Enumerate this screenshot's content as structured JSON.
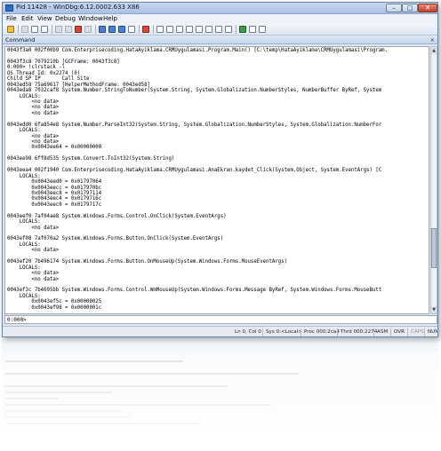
{
  "window": {
    "title": "Pid 11428 - WinDbg:6.12.0002.633 X86",
    "min_symbol": "–",
    "max_symbol": "□",
    "close_symbol": "✕"
  },
  "menu": [
    "File",
    "Edit",
    "View",
    "Debug",
    "Window",
    "Help"
  ],
  "toolbar_icons": [
    "open-icon",
    "cut-icon",
    "copy-icon",
    "paste-icon",
    "go-icon",
    "restart-icon",
    "stop-icon",
    "break-icon",
    "step-into-icon",
    "step-over-icon",
    "step-out-icon",
    "run-to-cursor-icon",
    "breakpoint-icon",
    "command-window-icon",
    "watch-icon",
    "locals-icon",
    "registers-icon",
    "memory-icon",
    "call-stack-icon",
    "disassembly-icon",
    "scratch-pad-icon",
    "source-mode-icon",
    "font-icon",
    "options-icon"
  ],
  "command_panel": {
    "label": "Command",
    "close_symbol": "×",
    "lines": [
      "0043f3a0 002f00b9 Com.Enterprisecoding.HataAyiklama.CRMUygulamasi.Program.Main() [C:\\temp\\HataAyiklama\\CRMUygulamasi\\Program.",
      "",
      "0043f3c8 7079210b [GCFrame: 0043f3c8]",
      "0:000> !clrstack -l",
      "OS Thread Id: 0x2274 (0)",
      "Child SP IP       Call Site",
      "0043ed58 75a69617 [HelperMethodFrame: 0043ed58]",
      "0043eda8 7032caf8 System.Number.StringToNumber(System.String, System.Globalization.NumberStyles, NumberBuffer ByRef, System",
      "    LOCALS:",
      "        <no data>",
      "        <no data>",
      "        <no data>",
      "",
      "0043edd0 6fa854e8 System.Number.ParseInt32(System.String, System.Globalization.NumberStyles, System.Globalization.NumberFor",
      "    LOCALS:",
      "        <no data>",
      "        <no data>",
      "        0x0043ee64 = 0x00000000",
      "",
      "0043ee98 6ff8d535 System.Convert.ToInt32(System.String)",
      "",
      "0043eea4 002f1940 Com.Enterprisecoding.HataAyiklama.CRMUygulamasi.AnaEkran.kaydet_Click(System.Object, System.EventArgs) [C",
      "    LOCALS:",
      "        0x0043eed0 = 0x01797064",
      "        0x0043eecc = 0x017970bc",
      "        0x0043eec8 = 0x01797114",
      "        0x0043eec4 = 0x0179716c",
      "        0x0043eec0 = 0x0179717c",
      "",
      "0043eef0 7af04ae8 System.Windows.Forms.Control.OnClick(System.EventArgs)",
      "    LOCALS:",
      "        <no data>",
      "",
      "0043ef08 7af070a2 System.Windows.Forms.Button.OnClick(System.EventArgs)",
      "    LOCALS:",
      "        <no data>",
      "",
      "0043ef20 7b496174 System.Windows.Forms.Button.OnMouseUp(System.Windows.Forms.MouseEventArgs)",
      "    LOCALS:",
      "        <no data>",
      "        <no data>",
      "",
      "0043ef3c 7b4695bb System.Windows.Forms.Control.WmMouseUp(System.Windows.Forms.Message ByRef, System.Windows.Forms.MouseButt",
      "    LOCALS:",
      "        0x0043ef5c = 0x00000025",
      "        0x0043ef98 = 0x0000001c"
    ]
  },
  "prompt": "0:000>",
  "input_value": "",
  "status": [
    "Ln 0, Col 0",
    "Sys 0:<Local>",
    "Proc 000:2ca4",
    "Thrd 000:2274",
    "ASM",
    "OVR",
    "CAPS",
    "NUM"
  ],
  "scrollbar": {
    "up_symbol": "▲",
    "down_symbol": "▼",
    "position_fraction": 0.82
  }
}
